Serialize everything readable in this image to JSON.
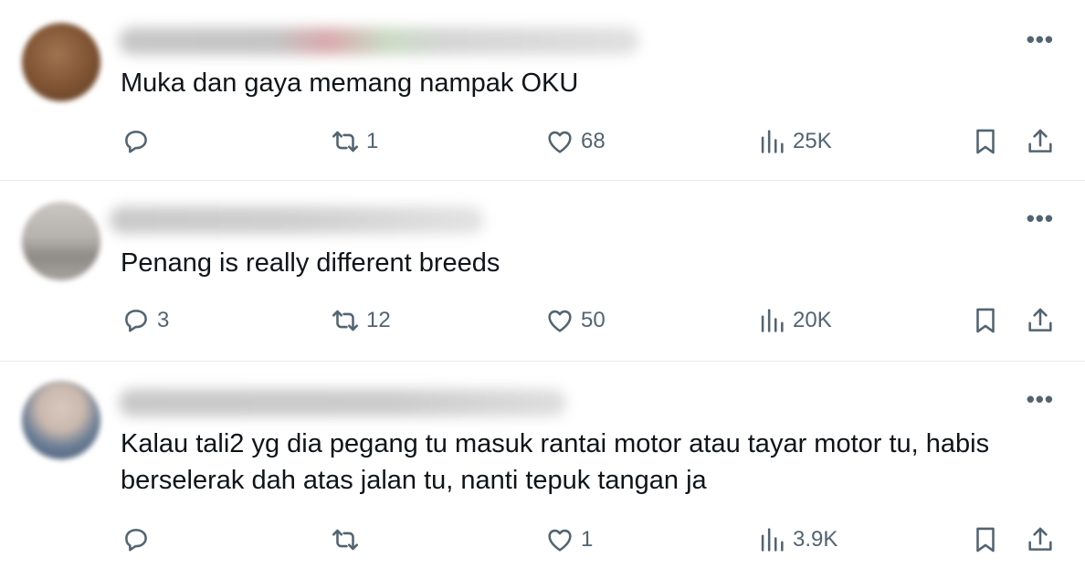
{
  "replies": [
    {
      "text": "Muka dan gaya memang nampak OKU",
      "more": "•••",
      "reply_count": "",
      "retweet_count": "1",
      "like_count": "68",
      "view_count": "25K"
    },
    {
      "text": "Penang is really different breeds",
      "more": "•••",
      "reply_count": "3",
      "retweet_count": "12",
      "like_count": "50",
      "view_count": "20K"
    },
    {
      "text": "Kalau tali2 yg dia pegang tu masuk rantai motor atau tayar motor tu, habis berselerak dah atas jalan tu, nanti tepuk tangan ja",
      "more": "•••",
      "reply_count": "",
      "retweet_count": "",
      "like_count": "1",
      "view_count": "3.9K"
    }
  ],
  "icons": {
    "reply": "reply-icon",
    "retweet": "retweet-icon",
    "like": "heart-icon",
    "views": "views-icon",
    "bookmark": "bookmark-icon",
    "share": "share-icon",
    "more": "more-icon"
  },
  "colors": {
    "text": "#0f1419",
    "secondary": "#536471",
    "divider": "#e7e9ea"
  }
}
